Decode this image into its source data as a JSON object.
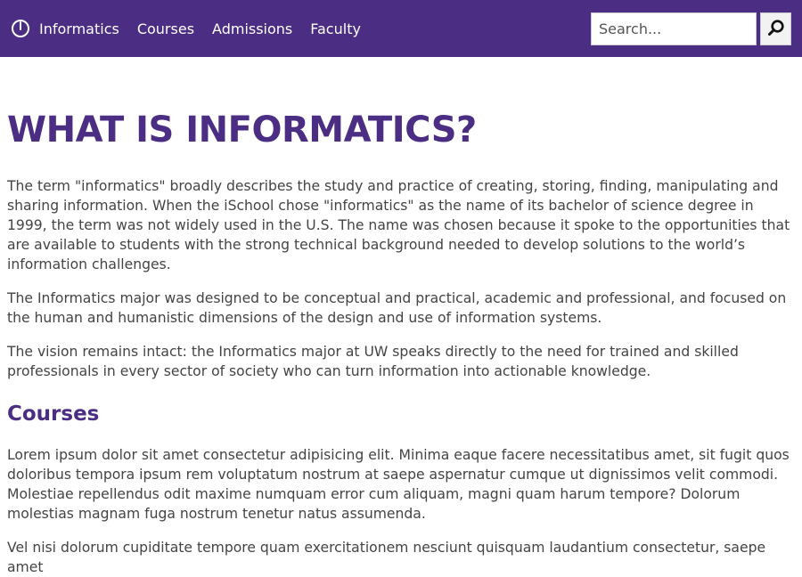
{
  "nav": {
    "brand": "Informatics",
    "links": [
      "Courses",
      "Admissions",
      "Faculty"
    ]
  },
  "search": {
    "placeholder": "Search..."
  },
  "main": {
    "title": "WHAT IS INFORMATICS?",
    "intro_paragraphs": [
      "The term \"informatics\" broadly describes the study and practice of creating, storing, finding, manipulating and sharing information. When the iSchool chose \"informatics\" as the name of its bachelor of science degree in 1999, the term was not widely used in the U.S. The name was chosen because it spoke to the opportunities that are available to students with the strong technical background needed to develop solutions to the world’s information challenges.",
      "The Informatics major was designed to be conceptual and practical, academic and professional, and focused on the human and humanistic dimensions of the design and use of information systems.",
      "The vision remains intact: the Informatics major at UW speaks directly to the need for trained and skilled professionals in every sector of society who can turn information into actionable knowledge."
    ],
    "courses_heading": "Courses",
    "courses_paragraphs": [
      "Lorem ipsum dolor sit amet consectetur adipisicing elit. Minima eaque facere necessitatibus amet, sit fugit quos doloribus tempora ipsum rem voluptatum nostrum at saepe aspernatur cumque ut dignissimos velit commodi. Molestiae repellendus odit maxime numquam error cum aliquam, magni quam harum tempore? Dolorum molestias magnam fuga nostrum tenetur natus assumenda.",
      "Vel nisi dolorum cupiditate tempore quam exercitationem nesciunt quisquam laudantium consectetur, saepe amet"
    ]
  },
  "colors": {
    "nav_bg": "#4b2e83",
    "heading": "#4b2e83",
    "body_text": "#444444"
  }
}
